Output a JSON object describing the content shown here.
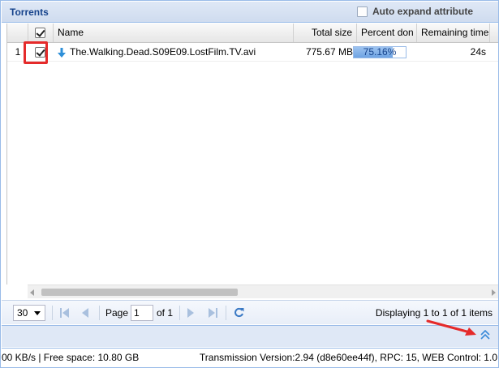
{
  "panel": {
    "title": "Torrents",
    "auto_expand_label": "Auto expand attribute"
  },
  "columns": {
    "name": "Name",
    "total_size": "Total size",
    "percent_done": "Percent don",
    "remaining_time": "Remaining time"
  },
  "rows": [
    {
      "index": "1",
      "name": "The.Walking.Dead.S09E09.LostFilm.TV.avi",
      "total_size": "775.67 MB",
      "percent_text": "75.16%",
      "percent_value": 0.7516,
      "remaining_time": "24s"
    }
  ],
  "paging": {
    "page_size": "30",
    "page_label": "Page",
    "page_value": "1",
    "of_label": "of 1",
    "display_msg": "Displaying 1 to 1 of 1 items"
  },
  "status": {
    "left": "00 KB/s | Free space: 10.80 GB",
    "right": "Transmission Version:2.94 (d8e60ee44f), RPC: 15, WEB Control: 1.0"
  },
  "colors": {
    "accent": "#15428b",
    "highlight_red": "#e52a2a",
    "progress": "#6ea3e3"
  }
}
